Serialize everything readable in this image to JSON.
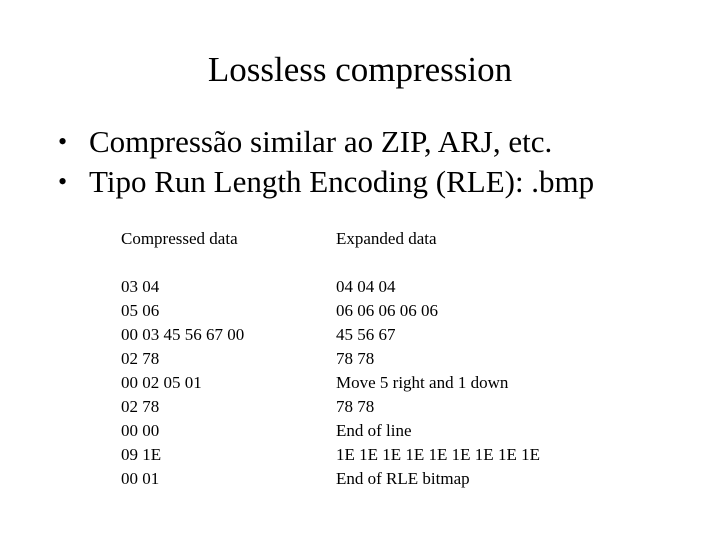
{
  "slide": {
    "title": "Lossless compression",
    "bullets": [
      {
        "icon": "bullet-dot",
        "glyph": "•",
        "text": "Compressão similar ao ZIP, ARJ, etc."
      },
      {
        "icon": "bullet-dot",
        "glyph": "•",
        "text": "Tipo Run Length Encoding (RLE): .bmp"
      }
    ]
  },
  "table": {
    "headers": {
      "compressed": "Compressed data",
      "expanded": "Expanded data"
    },
    "rows": [
      {
        "compressed": "03 04",
        "expanded": "04 04 04"
      },
      {
        "compressed": "05 06",
        "expanded": "06 06 06 06 06"
      },
      {
        "compressed": "00 03 45 56 67 00",
        "expanded": "45 56 67"
      },
      {
        "compressed": "02 78",
        "expanded": "78 78"
      },
      {
        "compressed": "00 02 05 01",
        "expanded": "Move 5 right and 1 down"
      },
      {
        "compressed": "02 78",
        "expanded": "78 78"
      },
      {
        "compressed": "00 00",
        "expanded": "End of line"
      },
      {
        "compressed": "09 1E",
        "expanded": "1E 1E 1E 1E 1E 1E 1E 1E 1E"
      },
      {
        "compressed": "00 01",
        "expanded": "End of RLE bitmap"
      }
    ]
  }
}
